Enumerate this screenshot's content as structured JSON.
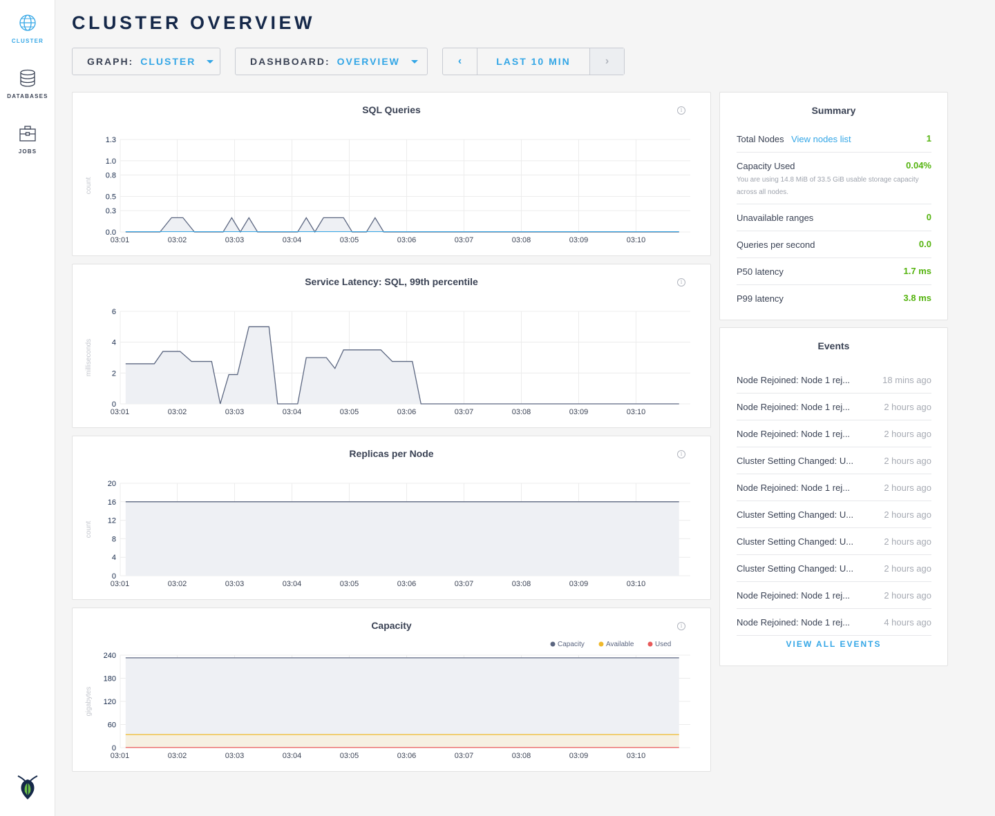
{
  "sidebar": {
    "items": [
      {
        "label": "CLUSTER",
        "icon": "globe-icon",
        "active": true
      },
      {
        "label": "DATABASES",
        "icon": "database-icon",
        "active": false
      },
      {
        "label": "JOBS",
        "icon": "briefcase-icon",
        "active": false
      }
    ],
    "logo": "cockroach-logo"
  },
  "header": {
    "title": "CLUSTER OVERVIEW",
    "graph_label": "GRAPH:",
    "graph_value": "CLUSTER",
    "dashboard_label": "DASHBOARD:",
    "dashboard_value": "OVERVIEW",
    "time_prev": "‹",
    "time_label": "LAST 10 MIN",
    "time_next": "›"
  },
  "colors": {
    "accent": "#33a6e6",
    "value_green": "#54b30e",
    "series_primary": "#5b6680",
    "series_fill": "#eef0f4",
    "available": "#f0b92b",
    "used": "#e85a5a"
  },
  "chart_data": [
    {
      "id": "sql",
      "type": "area",
      "title": "SQL Queries",
      "ylabel": "count",
      "ylim": [
        0,
        1.3
      ],
      "yticks": [
        "0.0",
        "0.3",
        "0.5",
        "0.8",
        "1.0",
        "1.3"
      ],
      "ytick_values": [
        0,
        0.3,
        0.5,
        0.8,
        1.0,
        1.3
      ],
      "xticks": [
        "03:01",
        "03:02",
        "03:03",
        "03:04",
        "03:05",
        "03:06",
        "03:07",
        "03:08",
        "03:09",
        "03:10"
      ],
      "series": [
        {
          "color": "#5b6680",
          "points": [
            [
              0.1,
              0
            ],
            [
              0.7,
              0
            ],
            [
              0.9,
              0.2
            ],
            [
              1.1,
              0.2
            ],
            [
              1.3,
              0
            ],
            [
              1.8,
              0
            ],
            [
              1.95,
              0.2
            ],
            [
              2.1,
              0
            ],
            [
              2.25,
              0.2
            ],
            [
              2.4,
              0
            ],
            [
              3.1,
              0
            ],
            [
              3.25,
              0.2
            ],
            [
              3.4,
              0
            ],
            [
              3.55,
              0.2
            ],
            [
              3.9,
              0.2
            ],
            [
              4.05,
              0
            ],
            [
              4.3,
              0
            ],
            [
              4.45,
              0.2
            ],
            [
              4.6,
              0
            ],
            [
              9.75,
              0
            ]
          ]
        }
      ],
      "baseline_color": "#33a6e6"
    },
    {
      "id": "latency",
      "type": "area",
      "title": "Service Latency: SQL, 99th percentile",
      "ylabel": "milliseconds",
      "ylim": [
        0,
        6
      ],
      "yticks": [
        "0",
        "2",
        "4",
        "6"
      ],
      "ytick_values": [
        0,
        2,
        4,
        6
      ],
      "xticks": [
        "03:01",
        "03:02",
        "03:03",
        "03:04",
        "03:05",
        "03:06",
        "03:07",
        "03:08",
        "03:09",
        "03:10"
      ],
      "series": [
        {
          "color": "#5b6680",
          "points": [
            [
              0.1,
              2.6
            ],
            [
              0.6,
              2.6
            ],
            [
              0.75,
              3.4
            ],
            [
              1.05,
              3.4
            ],
            [
              1.25,
              2.75
            ],
            [
              1.6,
              2.75
            ],
            [
              1.75,
              0
            ],
            [
              1.9,
              1.9
            ],
            [
              2.05,
              1.9
            ],
            [
              2.25,
              5
            ],
            [
              2.6,
              5
            ],
            [
              2.75,
              0
            ],
            [
              3.1,
              0
            ],
            [
              3.25,
              3
            ],
            [
              3.6,
              3
            ],
            [
              3.75,
              2.3
            ],
            [
              3.9,
              3.5
            ],
            [
              4.55,
              3.5
            ],
            [
              4.75,
              2.75
            ],
            [
              5.1,
              2.75
            ],
            [
              5.25,
              0
            ],
            [
              9.75,
              0
            ]
          ]
        }
      ]
    },
    {
      "id": "replicas",
      "type": "area",
      "title": "Replicas per Node",
      "ylabel": "count",
      "ylim": [
        0,
        20
      ],
      "yticks": [
        "0",
        "4",
        "8",
        "12",
        "16",
        "20"
      ],
      "ytick_values": [
        0,
        4,
        8,
        12,
        16,
        20
      ],
      "xticks": [
        "03:01",
        "03:02",
        "03:03",
        "03:04",
        "03:05",
        "03:06",
        "03:07",
        "03:08",
        "03:09",
        "03:10"
      ],
      "series": [
        {
          "color": "#5b6680",
          "points": [
            [
              0.1,
              16
            ],
            [
              9.75,
              16
            ]
          ]
        }
      ]
    },
    {
      "id": "capacity",
      "type": "area",
      "title": "Capacity",
      "ylabel": "gigabytes",
      "ylim": [
        0,
        240
      ],
      "yticks": [
        "0",
        "60",
        "120",
        "180",
        "240"
      ],
      "ytick_values": [
        0,
        60,
        120,
        180,
        240
      ],
      "xticks": [
        "03:01",
        "03:02",
        "03:03",
        "03:04",
        "03:05",
        "03:06",
        "03:07",
        "03:08",
        "03:09",
        "03:10"
      ],
      "legend": [
        "Capacity",
        "Available",
        "Used"
      ],
      "series": [
        {
          "name": "Capacity",
          "color": "#5b6680",
          "fill": "#eef0f4",
          "points": [
            [
              0.1,
              233
            ],
            [
              9.75,
              233
            ]
          ]
        },
        {
          "name": "Available",
          "color": "#f0b92b",
          "fill": "#f6f0e2",
          "points": [
            [
              0.1,
              34
            ],
            [
              9.75,
              34
            ]
          ]
        },
        {
          "name": "Used",
          "color": "#e85a5a",
          "fill": "none",
          "points": [
            [
              0.1,
              0.5
            ],
            [
              9.75,
              0.5
            ]
          ]
        }
      ]
    }
  ],
  "summary": {
    "title": "Summary",
    "total_nodes_label": "Total Nodes",
    "view_nodes_link": "View nodes list",
    "total_nodes_value": "1",
    "capacity_label": "Capacity Used",
    "capacity_value": "0.04%",
    "capacity_sub": "You are using 14.8 MiB of 33.5 GiB usable storage capacity across all nodes.",
    "unavailable_label": "Unavailable ranges",
    "unavailable_value": "0",
    "qps_label": "Queries per second",
    "qps_value": "0.0",
    "p50_label": "P50 latency",
    "p50_value": "1.7 ms",
    "p99_label": "P99 latency",
    "p99_value": "3.8 ms"
  },
  "events": {
    "title": "Events",
    "items": [
      {
        "text": "Node Rejoined: Node 1 rej...",
        "time": "18 mins ago"
      },
      {
        "text": "Node Rejoined: Node 1 rej...",
        "time": "2 hours ago"
      },
      {
        "text": "Node Rejoined: Node 1 rej...",
        "time": "2 hours ago"
      },
      {
        "text": "Cluster Setting Changed: U...",
        "time": "2 hours ago"
      },
      {
        "text": "Node Rejoined: Node 1 rej...",
        "time": "2 hours ago"
      },
      {
        "text": "Cluster Setting Changed: U...",
        "time": "2 hours ago"
      },
      {
        "text": "Cluster Setting Changed: U...",
        "time": "2 hours ago"
      },
      {
        "text": "Cluster Setting Changed: U...",
        "time": "2 hours ago"
      },
      {
        "text": "Node Rejoined: Node 1 rej...",
        "time": "2 hours ago"
      },
      {
        "text": "Node Rejoined: Node 1 rej...",
        "time": "4 hours ago"
      }
    ],
    "view_all": "VIEW ALL EVENTS"
  }
}
